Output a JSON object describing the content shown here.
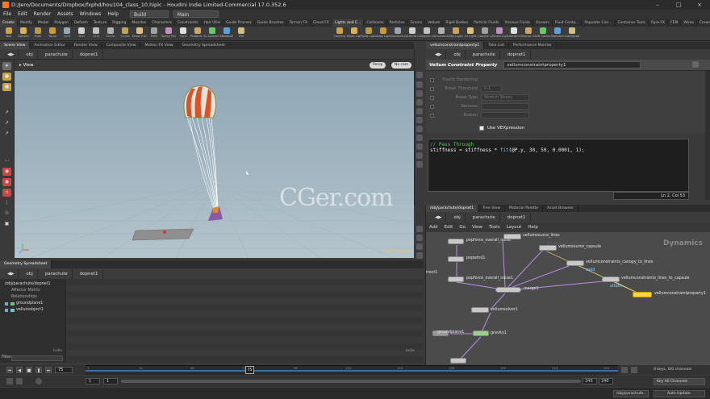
{
  "title": "D:/Jero/Documents/Dropbox/fxphd/hou104_class_10.hiplc - Houdini Indie Limited-Commercial 17.0.352.6",
  "menus": [
    "File",
    "Edit",
    "Render",
    "Assets",
    "Windows",
    "Help"
  ],
  "desktop_build": "Build",
  "desktop_main": "Main",
  "shelf_tabs_left": [
    "Create",
    "Modify",
    "Model",
    "Polygon",
    "Deform",
    "Texture",
    "Rigging",
    "Muscles",
    "Characters",
    "Constraints",
    "Hair Utils",
    "Guide Process",
    "Guide Brushes",
    "Terrain FX",
    "Cloud FX",
    "Volume"
  ],
  "shelf_tabs_right": [
    "Lights and C...",
    "Collisions",
    "Particles",
    "Grains",
    "Vellum",
    "Rigid Bodies",
    "Particle Fluids",
    "Viscous Fluids",
    "Oceans",
    "Fluid Conta...",
    "Populate Con...",
    "Container Tools",
    "Pyro FX",
    "FEM",
    "Wires",
    "Crowds",
    "Drive Simula..."
  ],
  "shelf_tools_left": [
    "Box",
    "Sphere",
    "Tube",
    "Torus",
    "Grid",
    "Null",
    "Line",
    "Circle",
    "Curve",
    "Draw Curve",
    "Path",
    "Spray Paint",
    "Font",
    "Platonic Solids",
    "L-System",
    "Metaball",
    "File"
  ],
  "shelf_tools_right": [
    "Camera",
    "Point Light",
    "Spot Light",
    "Area Light",
    "Geometry Light",
    "Volume Light",
    "Distant Light",
    "Environment Light",
    "Sky Light",
    "GI Light",
    "Caustic Light",
    "Portal Light",
    "Ambient Light",
    "Stereo Camera",
    "VR Camera",
    "Switcher",
    "Gamepad Camera"
  ],
  "left_pane_tabs": [
    "Scene View",
    "Animation Editor",
    "Render View",
    "Composite View",
    "Motion FX View",
    "Geometry Spreadsheet"
  ],
  "left_path": [
    "obj",
    "parachute",
    "dopnet1"
  ],
  "viewport_label": "View",
  "viewport_persp": "Persp",
  "viewport_cam": "No cam",
  "viewport_sim_label": "Solve Solution",
  "param_pane_tabs": [
    "vellumconstraintproperty1",
    "Take List",
    "Performance Monitor"
  ],
  "param_path": [
    "obj",
    "parachute",
    "dopnet1"
  ],
  "param_node_type": "Vellum Constraint Property",
  "param_node_name": "vellumconstraintproperty1",
  "params": [
    {
      "label": "Plastic Hardening",
      "value": ""
    },
    {
      "label": "Break Threshold",
      "value": "0.1"
    },
    {
      "label": "Break Type",
      "value": "Stretch Stress"
    },
    {
      "label": "Remove",
      "value": ""
    },
    {
      "label": "Broken",
      "value": ""
    }
  ],
  "vex_toggle_label": "Use VEXpression",
  "code": {
    "comment": "// Pass Through",
    "line2_a": "stiffness = stiffness * ",
    "line2_fn": "fit",
    "line2_b": "(@P.y, 30, 50, 0.0001, 1);"
  },
  "code_status": "Ln 2, Col 53",
  "network_tabs": [
    "/obj/parachute/dopnet1",
    "Tree View",
    "Material Palette",
    "Asset Browser"
  ],
  "network_path": [
    "obj",
    "parachute",
    "dopnet1"
  ],
  "network_menus": [
    "Add",
    "Edit",
    "Go",
    "View",
    "Tools",
    "Layout",
    "Help"
  ],
  "network_context": "Dynamics",
  "network_watermark": "Indie Edition",
  "nodes": {
    "popforce_noise": "popforce_overall_noise",
    "popwind": "popwind1",
    "popforce_noise2": "popforce_overall_noise1",
    "merge": "merge1",
    "vellumsolver": "vellumsolver1",
    "groundplane": "groundplane1",
    "gravity": "gravity1",
    "source_lines": "vellumsource_lines",
    "source_capsule": "vellumsource_capsule",
    "cons_canopy": "vellumconstraints_canopy_to_lines",
    "cons_lines": "vellumconstraints_lines_to_capsule",
    "cons_prop": "vellumconstraintproperty1",
    "out1": "rrect1",
    "lbl_weld": "weld",
    "lbl_attach": "attach"
  },
  "spread_tabs": [
    "Geometry Spreadsheet"
  ],
  "spread_path": [
    "obj",
    "parachute",
    "dopnet1"
  ],
  "tree_items": [
    "/obj/parachute/dopnet1",
    "Affector Matrix",
    "Relationships",
    "groundplane1",
    "vellumobject1"
  ],
  "spread_filter": "Filter",
  "spread_indie": "Indie",
  "timeline": {
    "current_frame": "75",
    "start": "1",
    "end": "240",
    "end2": "240",
    "ticks": [
      "1",
      "24",
      "48",
      "72",
      "96",
      "120",
      "144",
      "168",
      "192",
      "216",
      "240"
    ]
  },
  "keys_info": "0 keys, 0/0 channels",
  "key_all": "Key All Channels",
  "status_path": "/obj/parachute...",
  "auto_update": "Auto Update",
  "watermark": "CGer.com",
  "colors": {
    "accent": "#ffb000",
    "node_sel": "#ffd24a",
    "wire": "#b98ee8"
  }
}
